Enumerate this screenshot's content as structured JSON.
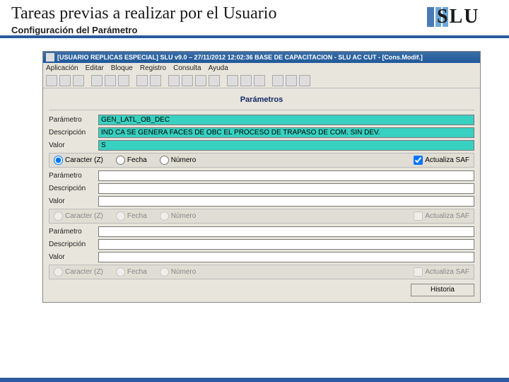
{
  "slide": {
    "title": "Tareas previas a realizar por el Usuario",
    "subtitle": "Configuración del Parámetro"
  },
  "logo": {
    "text": "SLU"
  },
  "app": {
    "title": "[USUARIO REPLICAS ESPECIAL] SLU v9.0 – 27/11/2012 12:02:36 BASE DE CAPACITACION - SLU AC CUT - [Cons.Modif.]",
    "menu": {
      "m1": "Aplicación",
      "m2": "Editar",
      "m3": "Bloque",
      "m4": "Registro",
      "m5": "Consulta",
      "m6": "Ayuda"
    },
    "sectionTitle": "Parámetros",
    "labels": {
      "parametro": "Parámetro",
      "descripcion": "Descripción",
      "valor": "Valor"
    },
    "radios": {
      "caracter": "Caracter (Z)",
      "fecha": "Fecha",
      "numero": "Número"
    },
    "checkbox": {
      "actualizaSAF": "Actualiza SAF"
    },
    "group1": {
      "parametro": "GEN_LATL_OB_DEC",
      "descripcion": "IND CA SE GENERA FACES DE OBC EL PROCESO DE TRAPASO DE COM. SIN DEV.",
      "valor": "S",
      "selectedRadio": "caracter",
      "actualizaSAF": true
    },
    "group2": {
      "parametro": "",
      "descripcion": "",
      "valor": "",
      "actualizaSAF": false
    },
    "group3": {
      "parametro": "",
      "descripcion": "",
      "valor": "",
      "actualizaSAF": false
    },
    "buttons": {
      "historia": "Historia"
    }
  }
}
